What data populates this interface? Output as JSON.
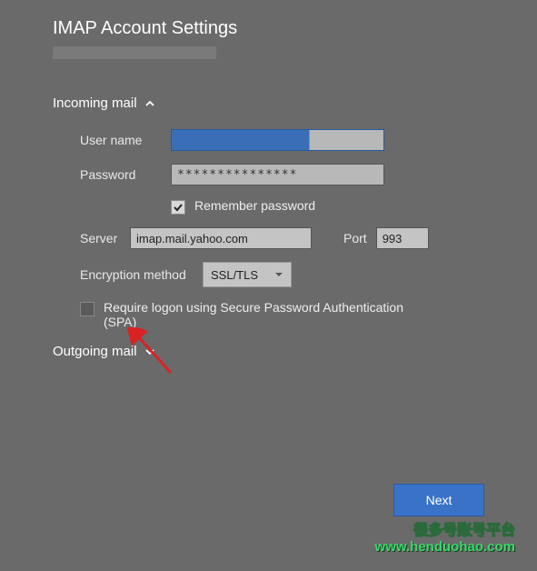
{
  "title": "IMAP Account Settings",
  "incoming": {
    "header": "Incoming mail",
    "expanded": true,
    "username_label": "User name",
    "username_value": "",
    "password_label": "Password",
    "password_value": "***************",
    "remember_label": "Remember password",
    "remember_checked": true,
    "server_label": "Server",
    "server_value": "imap.mail.yahoo.com",
    "port_label": "Port",
    "port_value": "993",
    "encryption_label": "Encryption method",
    "encryption_value": "SSL/TLS",
    "spa_label": "Require logon using Secure Password Authentication (SPA)",
    "spa_checked": false
  },
  "outgoing": {
    "header": "Outgoing mail",
    "expanded": false
  },
  "buttons": {
    "next": "Next"
  },
  "watermark": {
    "line1": "很多号账号平台",
    "line2": "www.henduohao.com"
  }
}
